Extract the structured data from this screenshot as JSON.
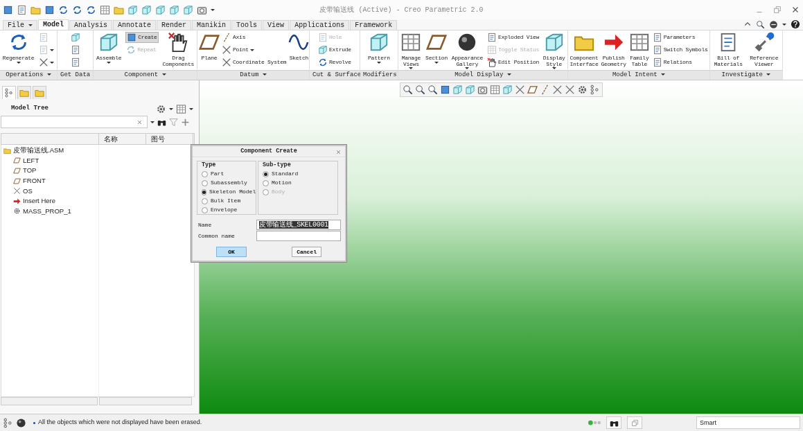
{
  "window": {
    "title": "皮带输送线 (Active) - Creo Parametric 2.0"
  },
  "tabs": [
    {
      "label": "File",
      "selected": false,
      "menu": true
    },
    {
      "label": "Model",
      "selected": true,
      "menu": false
    },
    {
      "label": "Analysis",
      "selected": false,
      "menu": false
    },
    {
      "label": "Annotate",
      "selected": false,
      "menu": false
    },
    {
      "label": "Render",
      "selected": false,
      "menu": false
    },
    {
      "label": "Manikin",
      "selected": false,
      "menu": false
    },
    {
      "label": "Tools",
      "selected": false,
      "menu": false
    },
    {
      "label": "View",
      "selected": false,
      "menu": false
    },
    {
      "label": "Applications",
      "selected": false,
      "menu": false
    },
    {
      "label": "Framework",
      "selected": false,
      "menu": false
    }
  ],
  "ribbon": {
    "groups": [
      {
        "label": "Operations",
        "commands": [
          {
            "kind": "large",
            "label": "Regenerate",
            "menu": true,
            "disabled": false,
            "selected": false
          },
          {
            "kind": "icon",
            "menu": false,
            "disabled": true,
            "selected": false
          },
          {
            "kind": "icon",
            "menu": true,
            "disabled": true,
            "selected": false
          },
          {
            "kind": "icon",
            "menu": true,
            "disabled": false,
            "selected": false
          }
        ]
      },
      {
        "label": "Get Data",
        "commands": [
          {
            "kind": "icon",
            "menu": false,
            "disabled": false,
            "selected": false
          },
          {
            "kind": "icon",
            "menu": false,
            "disabled": false,
            "selected": false
          },
          {
            "kind": "icon",
            "menu": false,
            "disabled": false,
            "selected": false
          }
        ]
      },
      {
        "label": "Component",
        "commands": [
          {
            "kind": "large",
            "label": "Assemble",
            "menu": true,
            "disabled": false,
            "selected": false
          },
          {
            "kind": "small",
            "label": "Create",
            "menu": false,
            "disabled": false,
            "selected": true
          },
          {
            "kind": "small",
            "label": "Repeat",
            "menu": false,
            "disabled": true,
            "selected": false
          },
          {
            "kind": "large",
            "label": "Drag\nComponents",
            "menu": false,
            "disabled": false,
            "selected": false
          }
        ]
      },
      {
        "label": "Datum",
        "commands": [
          {
            "kind": "large",
            "label": "Plane",
            "menu": false,
            "disabled": false,
            "selected": false
          },
          {
            "kind": "small",
            "label": "Axis",
            "menu": false,
            "disabled": false,
            "selected": false
          },
          {
            "kind": "small",
            "label": "Point",
            "menu": true,
            "disabled": false,
            "selected": false
          },
          {
            "kind": "small",
            "label": "Coordinate System",
            "menu": false,
            "disabled": false,
            "selected": false
          },
          {
            "kind": "large",
            "label": "Sketch",
            "menu": false,
            "disabled": false,
            "selected": false
          }
        ]
      },
      {
        "label": "Cut & Surface",
        "commands": [
          {
            "kind": "small",
            "label": "Hole",
            "menu": false,
            "disabled": true,
            "selected": false
          },
          {
            "kind": "small",
            "label": "Extrude",
            "menu": false,
            "disabled": false,
            "selected": false
          },
          {
            "kind": "small",
            "label": "Revolve",
            "menu": false,
            "disabled": false,
            "selected": false
          }
        ]
      },
      {
        "label": "Modifiers",
        "commands": [
          {
            "kind": "large",
            "label": "Pattern",
            "menu": true,
            "disabled": false,
            "selected": false
          }
        ]
      },
      {
        "label": "Model Display",
        "commands": [
          {
            "kind": "large",
            "label": "Manage\nViews",
            "menu": true,
            "disabled": false,
            "selected": false
          },
          {
            "kind": "large",
            "label": "Section",
            "menu": true,
            "disabled": false,
            "selected": false
          },
          {
            "kind": "large",
            "label": "Appearance\nGallery",
            "menu": true,
            "disabled": false,
            "selected": false
          },
          {
            "kind": "small",
            "label": "Exploded View",
            "menu": false,
            "disabled": false,
            "selected": false
          },
          {
            "kind": "small",
            "label": "Toggle Status",
            "menu": false,
            "disabled": true,
            "selected": false
          },
          {
            "kind": "small",
            "label": "Edit Position",
            "menu": false,
            "disabled": false,
            "selected": false
          },
          {
            "kind": "large",
            "label": "Display\nStyle",
            "menu": true,
            "disabled": false,
            "selected": false
          }
        ]
      },
      {
        "label": "Model Intent",
        "commands": [
          {
            "kind": "large",
            "label": "Component\nInterface",
            "menu": false,
            "disabled": false,
            "selected": false
          },
          {
            "kind": "large",
            "label": "Publish\nGeometry",
            "menu": false,
            "disabled": false,
            "selected": false
          },
          {
            "kind": "large",
            "label": "Family\nTable",
            "menu": false,
            "disabled": false,
            "selected": false
          },
          {
            "kind": "small",
            "label": "Parameters",
            "menu": false,
            "disabled": false,
            "selected": false
          },
          {
            "kind": "small",
            "label": "Switch Symbols",
            "menu": false,
            "disabled": false,
            "selected": false
          },
          {
            "kind": "small",
            "label": "Relations",
            "menu": false,
            "disabled": false,
            "selected": false
          }
        ]
      },
      {
        "label": "Investigate",
        "commands": [
          {
            "kind": "large",
            "label": "Bill of\nMaterials",
            "menu": false,
            "disabled": false,
            "selected": false
          },
          {
            "kind": "large",
            "label": "Reference\nViewer",
            "menu": false,
            "disabled": false,
            "selected": false
          }
        ]
      }
    ]
  },
  "model_tree": {
    "tabs": [
      {
        "selected": true
      },
      {
        "selected": false
      },
      {
        "selected": false
      }
    ],
    "title": "Model Tree",
    "columns": [
      "名称",
      "图号"
    ],
    "items": [
      {
        "label": "皮带输送线.ASM",
        "children": [
          {
            "label": "LEFT"
          },
          {
            "label": "TOP"
          },
          {
            "label": "FRONT"
          },
          {
            "label": "OS"
          },
          {
            "label": "Insert Here"
          },
          {
            "label": "MASS_PROP_1"
          }
        ]
      }
    ]
  },
  "dialog": {
    "title": "Component Create",
    "type": {
      "label": "Type",
      "options": [
        {
          "label": "Part",
          "selected": false,
          "disabled": false
        },
        {
          "label": "Subassembly",
          "selected": false,
          "disabled": false
        },
        {
          "label": "Skeleton Model",
          "selected": true,
          "disabled": false
        },
        {
          "label": "Bulk Item",
          "selected": false,
          "disabled": false
        },
        {
          "label": "Envelope",
          "selected": false,
          "disabled": false
        }
      ]
    },
    "subtype": {
      "label": "Sub-type",
      "options": [
        {
          "label": "Standard",
          "selected": true,
          "disabled": false
        },
        {
          "label": "Motion",
          "selected": false,
          "disabled": false
        },
        {
          "label": "Body",
          "selected": false,
          "disabled": true
        }
      ]
    },
    "fields": [
      {
        "label": "Name",
        "value": "皮带输送线_SKEL0001",
        "highlighted": true
      },
      {
        "label": "Common name"
      }
    ],
    "buttons": [
      {
        "label": "OK",
        "default": true
      },
      {
        "label": "Cancel",
        "default": false
      }
    ]
  },
  "status_bar": {
    "message": "All the objects which were not displayed have been erased.",
    "filter": "Smart"
  }
}
